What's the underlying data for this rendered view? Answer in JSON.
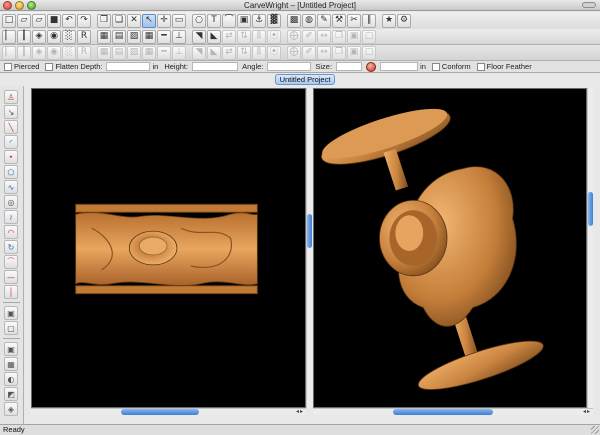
{
  "window": {
    "title": "CarveWright – [Untitled Project]"
  },
  "toolbar_main": [
    {
      "name": "new-file-icon",
      "glyph": "□"
    },
    {
      "name": "open-folder-icon",
      "glyph": "▱"
    },
    {
      "name": "open-project-icon",
      "glyph": "▱"
    },
    {
      "name": "save-icon",
      "glyph": "■"
    },
    {
      "name": "undo-icon",
      "glyph": "↶"
    },
    {
      "name": "redo-icon",
      "glyph": "↷"
    },
    {
      "name": "copy-icon",
      "glyph": "❐"
    },
    {
      "name": "paste-icon",
      "glyph": "❑"
    },
    {
      "name": "delete-icon",
      "glyph": "✕"
    },
    {
      "name": "select-arrow-icon",
      "glyph": "↖"
    },
    {
      "name": "move-tool-icon",
      "glyph": "✛"
    },
    {
      "name": "rectangle-tool-icon",
      "glyph": "▭"
    },
    {
      "name": "ellipse-tool-icon",
      "glyph": "○"
    },
    {
      "name": "text-tool-icon",
      "glyph": "T"
    },
    {
      "name": "polyline-tool-icon",
      "glyph": "⌒"
    },
    {
      "name": "board-icon",
      "glyph": "▣"
    },
    {
      "name": "bit-icon",
      "glyph": "⚓"
    },
    {
      "name": "pattern-icon",
      "glyph": "▓"
    },
    {
      "name": "carve-region-icon",
      "glyph": "▩"
    },
    {
      "name": "cut-out-icon",
      "glyph": "◍"
    },
    {
      "name": "pen-tool-icon",
      "glyph": "✎"
    },
    {
      "name": "stamp-icon",
      "glyph": "⚒"
    },
    {
      "name": "scissors-icon",
      "glyph": "✂"
    },
    {
      "name": "measure-icon",
      "glyph": "∥"
    },
    {
      "name": "simulate-icon",
      "glyph": "★"
    },
    {
      "name": "gear-icon",
      "glyph": "⚙"
    }
  ],
  "toolbar_secondary": [
    {
      "name": "align-left-icon",
      "glyph": "▏"
    },
    {
      "name": "align-center-icon",
      "glyph": "┃"
    },
    {
      "name": "view-3d-icon",
      "glyph": "◈"
    },
    {
      "name": "eye-icon",
      "glyph": "◉"
    },
    {
      "name": "texture-icon",
      "glyph": "░"
    },
    {
      "name": "rough-icon",
      "glyph": "R"
    },
    {
      "name": "board-view-icon",
      "glyph": "▦"
    },
    {
      "name": "wood-icon",
      "glyph": "▤"
    },
    {
      "name": "pattern-view-icon",
      "glyph": "▨"
    },
    {
      "name": "grid-icon",
      "glyph": "▦"
    },
    {
      "name": "ruler-icon",
      "glyph": "━"
    },
    {
      "name": "clamp-icon",
      "glyph": "⊥"
    },
    {
      "name": "layer-up-icon",
      "glyph": "◥"
    },
    {
      "name": "layer-down-icon",
      "glyph": "◣"
    },
    {
      "name": "flip-h-icon",
      "glyph": "⇄"
    },
    {
      "name": "flip-v-icon",
      "glyph": "⇅"
    },
    {
      "name": "mirror-icon",
      "glyph": "⫼"
    },
    {
      "name": "weld-icon",
      "glyph": "⦿"
    },
    {
      "name": "merge-icon",
      "glyph": "⨁"
    },
    {
      "name": "trace-icon",
      "glyph": "✐"
    },
    {
      "name": "stretch-icon",
      "glyph": "↔"
    },
    {
      "name": "clone-icon",
      "glyph": "❐"
    },
    {
      "name": "group-icon",
      "glyph": "▣"
    },
    {
      "name": "ungroup-icon",
      "glyph": "▢"
    }
  ],
  "options_bar": {
    "pierced": "Pierced",
    "flatten": "Flatten",
    "depth": "Depth:",
    "depth_unit": "in",
    "height": "Height:",
    "angle": "Angle:",
    "size": "Size:",
    "size_unit": "in",
    "conform": "Conform",
    "floor_feather": "Floor Feather"
  },
  "document_tab": "Untitled Project",
  "left_tools": [
    {
      "name": "sculpt-tool-icon",
      "glyph": "♙",
      "tone": "red"
    },
    {
      "name": "pointer-tool-icon",
      "glyph": "↘",
      "tone": "gray"
    },
    {
      "name": "line-point-icon",
      "glyph": "╲",
      "tone": "red"
    },
    {
      "name": "arc-point-icon",
      "glyph": "◜",
      "tone": "blue"
    },
    {
      "name": "node-edit-icon",
      "glyph": "⬩",
      "tone": "red"
    },
    {
      "name": "polygon-icon",
      "glyph": "⬠",
      "tone": "blue"
    },
    {
      "name": "bezier-icon",
      "glyph": "∿",
      "tone": "blue"
    },
    {
      "name": "circle-select-icon",
      "glyph": "◎",
      "tone": "gray"
    },
    {
      "name": "spline-icon",
      "glyph": "≀",
      "tone": "blue"
    },
    {
      "name": "arc-icon",
      "glyph": "◠",
      "tone": "red"
    },
    {
      "name": "rotate-icon",
      "glyph": "↻",
      "tone": "blue"
    },
    {
      "name": "curve-in-icon",
      "glyph": "⁀",
      "tone": "red"
    },
    {
      "name": "horizontal-line-icon",
      "glyph": "—",
      "tone": "red"
    },
    {
      "name": "vertical-line-icon",
      "glyph": "│",
      "tone": "red"
    },
    {
      "name": "box-select-icon",
      "glyph": "▣",
      "tone": "gray"
    },
    {
      "name": "frame-icon",
      "glyph": "▢",
      "tone": "gray"
    },
    {
      "name": "inset-icon",
      "glyph": "▣",
      "tone": "gray"
    },
    {
      "name": "fill-icon",
      "glyph": "▦",
      "tone": "gray"
    },
    {
      "name": "sphere-icon",
      "glyph": "◐",
      "tone": "gray"
    },
    {
      "name": "drape-icon",
      "glyph": "◩",
      "tone": "gray"
    },
    {
      "name": "smooth-icon",
      "glyph": "◈",
      "tone": "gray"
    }
  ],
  "views": {
    "left": "top-view",
    "right": "3d-view"
  },
  "status": {
    "text": "Ready"
  },
  "colors": {
    "accent": "#3e7ed6",
    "wood_light": "#e7a25a",
    "wood_mid": "#c27a35",
    "wood_dark": "#7a4a1c",
    "viewport_bg": "#000000"
  }
}
